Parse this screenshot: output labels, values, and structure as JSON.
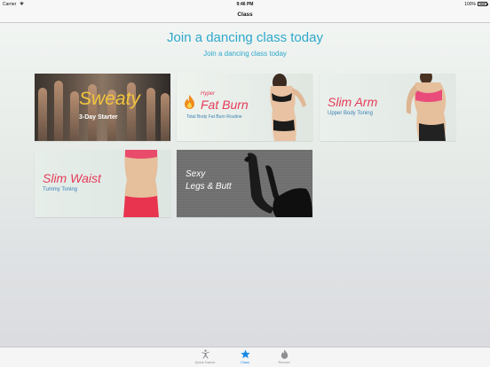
{
  "status_bar": {
    "carrier": "Carrier",
    "time": "9:46 PM",
    "battery": "100%"
  },
  "nav": {
    "title": "Class"
  },
  "header": {
    "title": "Join a dancing class today",
    "subtitle": "Join a dancing class today"
  },
  "cards": {
    "sweaty": {
      "title": "Sweaty",
      "subtitle": "3-Day Starter"
    },
    "fatburn": {
      "hyper": "Hyper",
      "title": "Fat Burn",
      "subtitle": "Total Body Fat Burn Routine"
    },
    "slimarm": {
      "title": "Slim Arm",
      "subtitle": "Upper Body Toning"
    },
    "slimwaist": {
      "title": "Slim Waist",
      "subtitle": "Tummy Toning"
    },
    "legs": {
      "line1": "Sexy",
      "line2": "Legs & Butt"
    }
  },
  "tabs": [
    {
      "label": "Quick Dance",
      "icon": "dancer-icon",
      "active": false
    },
    {
      "label": "Class",
      "icon": "star-icon",
      "active": true
    },
    {
      "label": "Record",
      "icon": "flame-icon",
      "active": false
    }
  ],
  "colors": {
    "accent": "#2ea8cc",
    "title_pink": "#e53b59",
    "sweaty_yellow": "#f2c53d",
    "tab_active": "#1a8ae6",
    "tab_inactive": "#8e8e93"
  }
}
